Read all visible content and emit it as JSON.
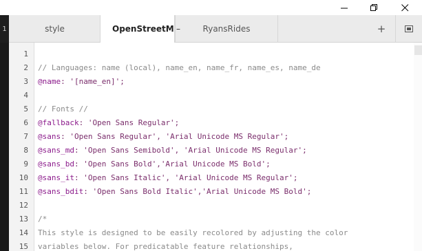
{
  "window": {
    "minimize_icon": "minimize-icon",
    "maximize_icon": "maximize-icon",
    "close_icon": "close-icon"
  },
  "left_stub": "1",
  "tabs": [
    {
      "label": "style",
      "active": false
    },
    {
      "label": "OpenStreetMap",
      "active": true,
      "close_glyph": "–"
    },
    {
      "label": "RyansRides",
      "active": false
    }
  ],
  "toolbar": {
    "new_tab_glyph": "+",
    "preview_icon": "preview-icon"
  },
  "editor": {
    "line_numbers": [
      "1",
      "2",
      "3",
      "4",
      "5",
      "6",
      "7",
      "8",
      "9",
      "10",
      "11",
      "12",
      "13",
      "14",
      "15"
    ],
    "lines": {
      "l2": "// Languages: name (local), name_en, name_fr, name_es, name_de",
      "l3_var": "@name",
      "l3_rest": ": '[name_en]';",
      "l5": "// Fonts //",
      "l6_var": "@fallback",
      "l6_rest": ": 'Open Sans Regular';",
      "l7_var": "@sans",
      "l7_rest": ": 'Open Sans Regular', 'Arial Unicode MS Regular';",
      "l8_var": "@sans_md",
      "l8_rest": ": 'Open Sans Semibold', 'Arial Unicode MS Regular';",
      "l9_var": "@sans_bd",
      "l9_rest": ": 'Open Sans Bold','Arial Unicode MS Bold';",
      "l10_var": "@sans_it",
      "l10_rest": ": 'Open Sans Italic', 'Arial Unicode MS Regular';",
      "l11_var": "@sans_bdit",
      "l11_rest": ": 'Open Sans Bold Italic','Arial Unicode MS Bold';",
      "l13": "/*",
      "l14": "This style is designed to be easily recolored by adjusting the color",
      "l15": "variables below. For predicatable feature relationships,"
    }
  },
  "colors": {
    "tab_bar": "#ebebeb",
    "active_tab": "#ffffff",
    "comment": "#8a8a8a",
    "variable": "#8b1a8b",
    "gutter": "#f3f3f3"
  }
}
